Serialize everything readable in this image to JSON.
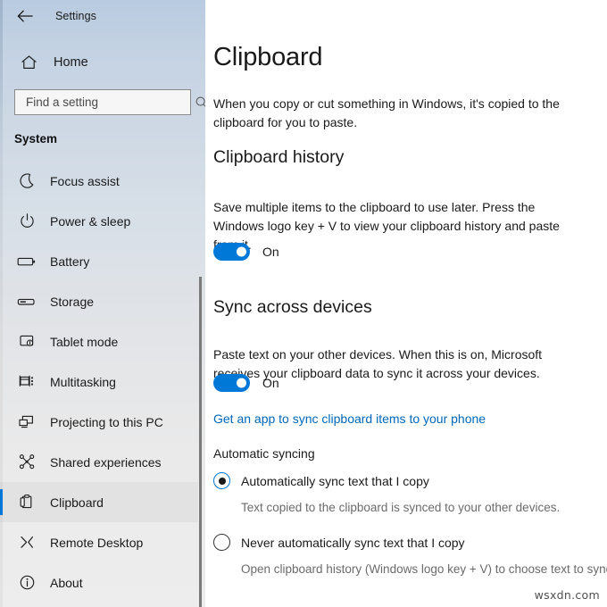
{
  "window": {
    "titlebar": {
      "back_icon": "back-arrow-icon",
      "title": "Settings"
    }
  },
  "sidebar": {
    "home": {
      "label": "Home",
      "icon": "home-icon"
    },
    "search": {
      "placeholder": "Find a setting",
      "value": "",
      "icon": "search-icon"
    },
    "group_header": "System",
    "items": [
      {
        "label": "Focus assist",
        "icon": "moon-icon",
        "selected": false
      },
      {
        "label": "Power & sleep",
        "icon": "power-icon",
        "selected": false
      },
      {
        "label": "Battery",
        "icon": "battery-icon",
        "selected": false
      },
      {
        "label": "Storage",
        "icon": "storage-drive-icon",
        "selected": false
      },
      {
        "label": "Tablet mode",
        "icon": "tablet-icon",
        "selected": false
      },
      {
        "label": "Multitasking",
        "icon": "multitasking-icon",
        "selected": false
      },
      {
        "label": "Projecting to this PC",
        "icon": "project-screen-icon",
        "selected": false
      },
      {
        "label": "Shared experiences",
        "icon": "share-nodes-icon",
        "selected": false
      },
      {
        "label": "Clipboard",
        "icon": "clipboard-icon",
        "selected": true
      },
      {
        "label": "Remote Desktop",
        "icon": "remote-desktop-icon",
        "selected": false
      },
      {
        "label": "About",
        "icon": "info-circle-icon",
        "selected": false
      }
    ]
  },
  "main": {
    "page_title": "Clipboard",
    "intro": "When you copy or cut something in Windows, it's copied to the clipboard for you to paste.",
    "clipboard_history": {
      "heading": "Clipboard history",
      "description": "Save multiple items to the clipboard to use later. Press the Windows logo key + V to view your clipboard history and paste from it.",
      "toggle_state": "On"
    },
    "sync_across_devices": {
      "heading": "Sync across devices",
      "description": "Paste text on your other devices. When this is on, Microsoft receives your clipboard data to sync it across your devices.",
      "toggle_state": "On",
      "link": "Get an app to sync clipboard items to your phone",
      "automatic_syncing_label": "Automatic syncing",
      "options": [
        {
          "label": "Automatically sync text that I copy",
          "help": "Text copied to the clipboard is synced to your other devices.",
          "selected": true
        },
        {
          "label": "Never automatically sync text that I copy",
          "help": "Open clipboard history (Windows logo key + V) to choose text to sync.",
          "selected": false
        }
      ]
    }
  },
  "watermark": "wsxdn.com",
  "colors": {
    "accent": "#0078d7",
    "link": "#0067b8",
    "text": "#1a1a1a",
    "muted_text": "#6b6b6b"
  }
}
